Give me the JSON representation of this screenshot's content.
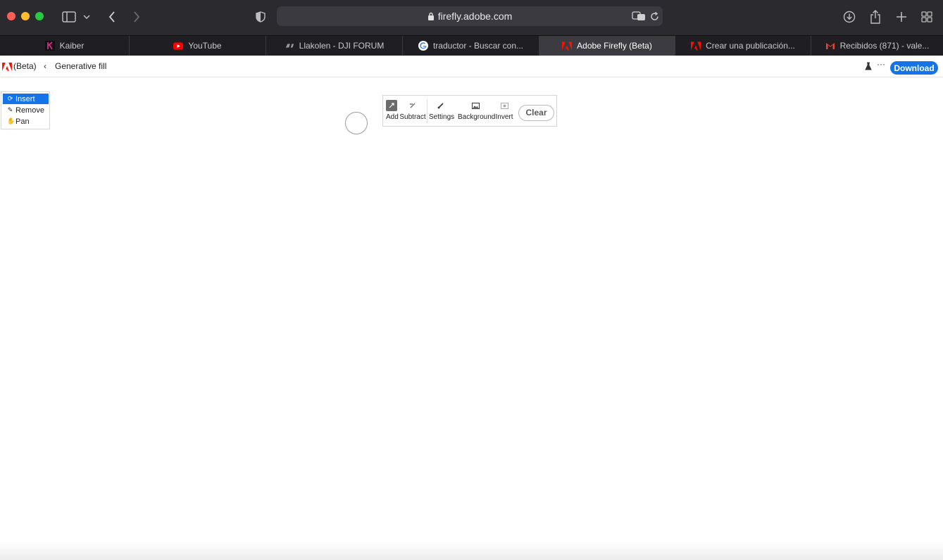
{
  "browser": {
    "url": "firefly.adobe.com",
    "tabs": [
      {
        "label": "Kaiber",
        "icon": "kaiber-icon",
        "active": false
      },
      {
        "label": "YouTube",
        "icon": "youtube-icon",
        "active": false
      },
      {
        "label": "Llakolen - DJI FORUM",
        "icon": "dji-icon",
        "active": false
      },
      {
        "label": "traductor - Buscar con...",
        "icon": "google-icon",
        "active": false
      },
      {
        "label": "Adobe Firefly (Beta)",
        "icon": "adobe-icon",
        "active": true
      },
      {
        "label": "Crear una publicación...",
        "icon": "adobe-icon",
        "active": false
      },
      {
        "label": "Recibidos (871) - vale...",
        "icon": "gmail-icon",
        "active": false
      }
    ]
  },
  "header": {
    "beta_label": "(Beta)",
    "back_chevron": "‹",
    "breadcrumb": "Generative fill",
    "more": "···",
    "download_label": "Download"
  },
  "tools": {
    "items": [
      {
        "label": "Insert",
        "icon": "insert-icon",
        "selected": true
      },
      {
        "label": "Remove",
        "icon": "remove-icon",
        "selected": false
      },
      {
        "label": "Pan",
        "icon": "hand-icon",
        "selected": false
      }
    ]
  },
  "fill_toolbar": {
    "add": "Add",
    "subtract": "Subtract",
    "settings": "Settings",
    "background": "Background",
    "invert": "Invert",
    "clear": "Clear"
  },
  "colors": {
    "accent": "#1473e6",
    "toolbar_bg": "#2b2a2f",
    "tabbar_bg": "#1f1e22"
  }
}
